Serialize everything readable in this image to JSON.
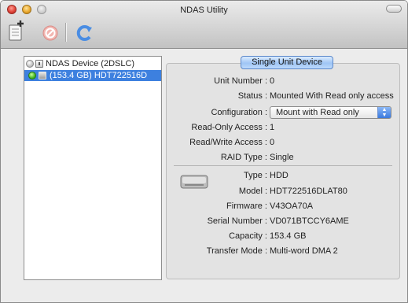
{
  "window": {
    "title": "NDAS Utility"
  },
  "toolbar": {
    "add_icon": "add-device-icon",
    "stop_icon": "stop-icon",
    "refresh_icon": "refresh-icon"
  },
  "tree": {
    "device": {
      "label": "NDAS Device (2DSLC)",
      "status_icon": "grey-status-icon",
      "icon": "device-icon"
    },
    "unit": {
      "label": "(153.4 GB) HDT722516D",
      "status_icon": "green-status-icon",
      "icon": "hdd-icon",
      "selected": true
    }
  },
  "panel": {
    "tab": "Single Unit Device",
    "fields": {
      "unit_number": {
        "label": "Unit Number :",
        "value": "0"
      },
      "status": {
        "label": "Status :",
        "value": "Mounted With Read only access"
      },
      "configuration": {
        "label": "Configuration :",
        "value": "Mount with Read only"
      },
      "ro_access": {
        "label": "Read-Only Access :",
        "value": "1"
      },
      "rw_access": {
        "label": "Read/Write Access :",
        "value": "0"
      },
      "raid_type": {
        "label": "RAID Type :",
        "value": "Single"
      },
      "type": {
        "label": "Type :",
        "value": "HDD"
      },
      "model": {
        "label": "Model :",
        "value": "HDT722516DLAT80"
      },
      "firmware": {
        "label": "Firmware :",
        "value": "V43OA70A"
      },
      "serial": {
        "label": "Serial Number :",
        "value": "VD071BTCCY6AME"
      },
      "capacity": {
        "label": "Capacity :",
        "value": "153.4 GB"
      },
      "transfer_mode": {
        "label": "Transfer Mode :",
        "value": "Multi-word DMA 2"
      }
    }
  },
  "colors": {
    "selection": "#3d80df",
    "panel_bg": "#e3e3e3",
    "window_bg": "#ececec",
    "status_green": "#39b01d"
  }
}
